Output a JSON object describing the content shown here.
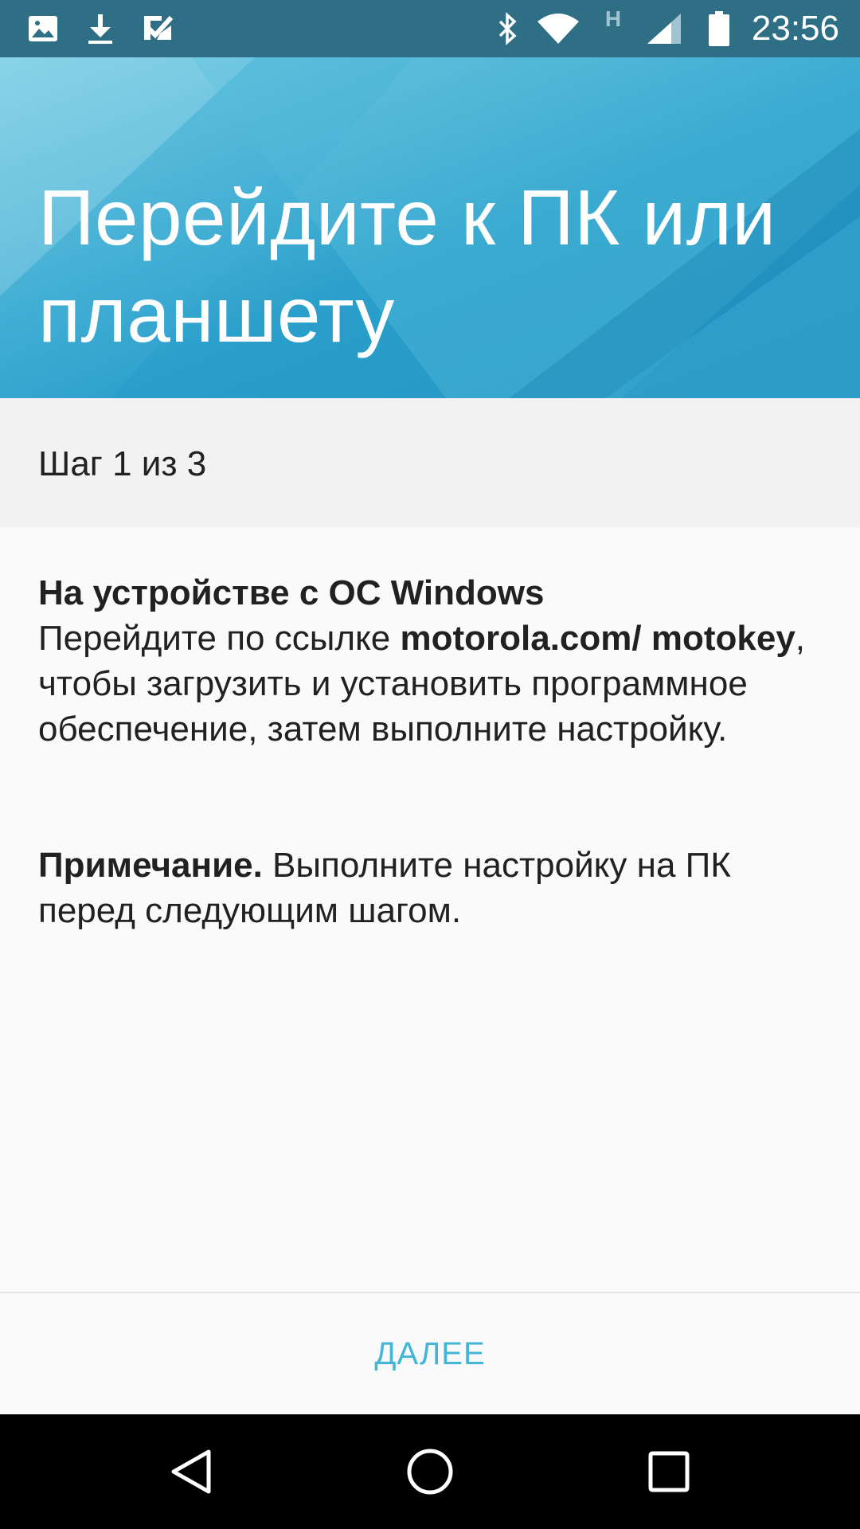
{
  "status_bar": {
    "time": "23:56",
    "network_type": "H",
    "left_icons": [
      "image-icon",
      "download-icon",
      "tasks-icon"
    ],
    "right_icons": [
      "bluetooth-icon",
      "wifi-icon",
      "signal-icon",
      "battery-icon"
    ]
  },
  "header": {
    "title": "Перейдите к ПК или планшету"
  },
  "step": {
    "text": "Шаг 1 из 3"
  },
  "content": {
    "section_title": "На устройстве с ОС Windows",
    "body_before_link": "Перейдите по ссылке ",
    "link_text": "motorola.com/ motokey",
    "body_after_link": ", чтобы загрузить и установить программное обеспечение, затем выполните настройку.",
    "note_label": "Примечание.",
    "note_text": " Выполните настройку на ПК перед следующим шагом."
  },
  "footer": {
    "next_label": "ДАЛЕЕ"
  },
  "nav": {
    "back": "back-icon",
    "home": "home-icon",
    "recents": "recents-icon"
  },
  "colors": {
    "accent": "#43b5d6",
    "header_bg": "#2ea3cf",
    "status_bar_bg": "#2e6f86"
  }
}
